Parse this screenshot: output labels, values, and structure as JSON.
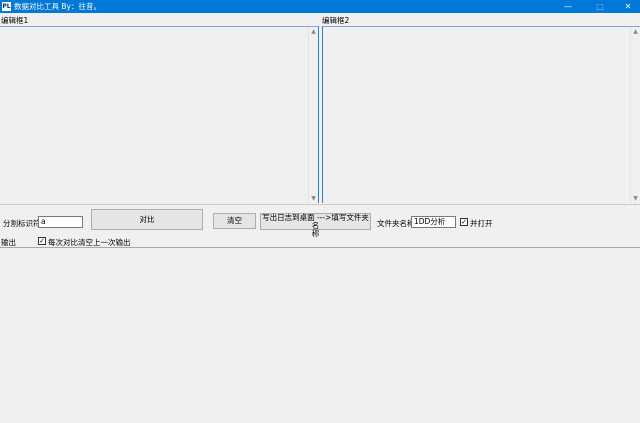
{
  "window": {
    "title": "数据对比工具   By：往昔。",
    "icon_text": "PL",
    "controls": {
      "minimize": "—",
      "maximize": "□",
      "close": "✕"
    }
  },
  "editors": {
    "left_label": "编辑框1",
    "right_label": "编辑框2"
  },
  "toolbar": {
    "separator_label": "分割标识符",
    "separator_value": "a",
    "compare_button": "对比",
    "clear_button": "清空",
    "log_button_line1": "写出日志到桌面    --->填写文件夹名",
    "log_button_line2": "称",
    "folder_label": "文件夹名称",
    "folder_value": "1DD分析",
    "open_checkbox_label": "并打开",
    "open_checked": true
  },
  "output": {
    "label": "输出",
    "clear_each_label": "每次对比清空上一次输出",
    "clear_each_checked": true
  },
  "icons": {
    "scroll_up": "▲",
    "scroll_down": "▼",
    "checkmark": "✓"
  }
}
